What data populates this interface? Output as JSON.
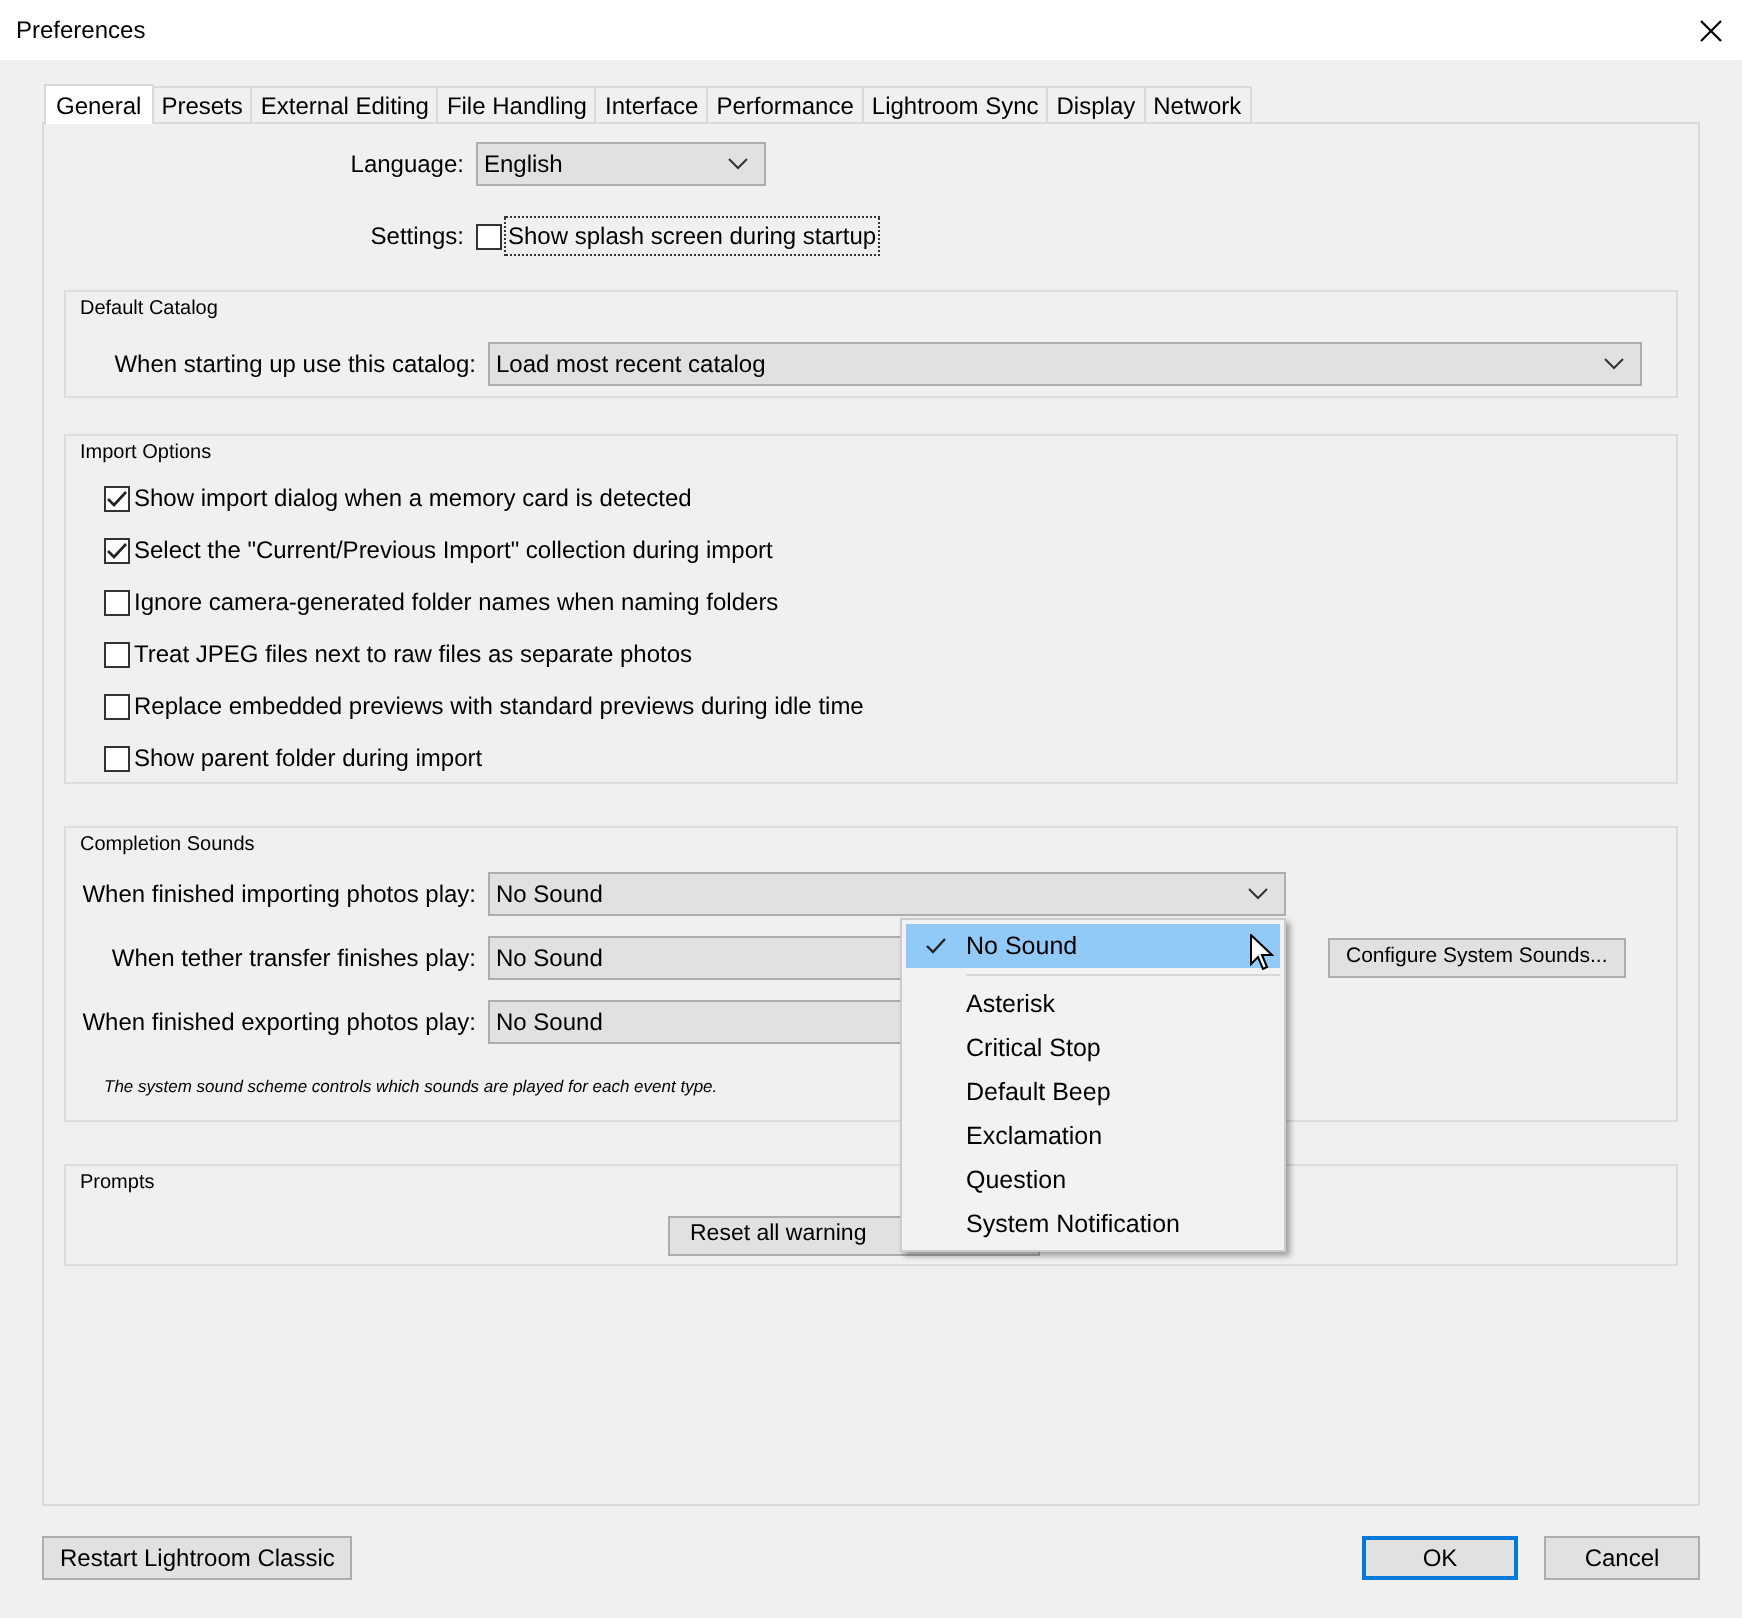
{
  "window": {
    "title": "Preferences"
  },
  "tabs": [
    {
      "label": "General",
      "selected": true
    },
    {
      "label": "Presets",
      "selected": false
    },
    {
      "label": "External Editing",
      "selected": false
    },
    {
      "label": "File Handling",
      "selected": false
    },
    {
      "label": "Interface",
      "selected": false
    },
    {
      "label": "Performance",
      "selected": false
    },
    {
      "label": "Lightroom Sync",
      "selected": false
    },
    {
      "label": "Display",
      "selected": false
    },
    {
      "label": "Network",
      "selected": false
    }
  ],
  "language": {
    "label": "Language:",
    "value": "English"
  },
  "settings": {
    "label": "Settings:",
    "option": "Show splash screen during startup",
    "checked": false
  },
  "default_catalog": {
    "title": "Default Catalog",
    "label": "When starting up use this catalog:",
    "value": "Load most recent catalog"
  },
  "import_options": {
    "title": "Import Options",
    "items": [
      {
        "label": "Show import dialog when a memory card is detected",
        "checked": true
      },
      {
        "label": "Select the \"Current/Previous Import\" collection during import",
        "checked": true
      },
      {
        "label": "Ignore camera-generated folder names when naming folders",
        "checked": false
      },
      {
        "label": "Treat JPEG files next to raw files as separate photos",
        "checked": false
      },
      {
        "label": "Replace embedded previews with standard previews during idle time",
        "checked": false
      },
      {
        "label": "Show parent folder during import",
        "checked": false
      }
    ]
  },
  "completion_sounds": {
    "title": "Completion Sounds",
    "rows": [
      {
        "label": "When finished importing photos play:",
        "value": "No Sound"
      },
      {
        "label": "When tether transfer finishes play:",
        "value": "No Sound"
      },
      {
        "label": "When finished exporting photos play:",
        "value": "No Sound"
      }
    ],
    "configure_button": "Configure System Sounds...",
    "note": "The system sound scheme controls which sounds are played for each event type."
  },
  "prompts": {
    "title": "Prompts",
    "button": "Reset all warning"
  },
  "sound_menu": [
    {
      "label": "No Sound",
      "selected": true
    },
    {
      "label": "Asterisk",
      "selected": false
    },
    {
      "label": "Critical Stop",
      "selected": false
    },
    {
      "label": "Default Beep",
      "selected": false
    },
    {
      "label": "Exclamation",
      "selected": false
    },
    {
      "label": "Question",
      "selected": false
    },
    {
      "label": "System Notification",
      "selected": false
    }
  ],
  "footer": {
    "restart_button": "Restart Lightroom Classic",
    "buttons": [
      {
        "label": "OK",
        "default": true
      },
      {
        "label": "Cancel",
        "default": false
      }
    ]
  }
}
